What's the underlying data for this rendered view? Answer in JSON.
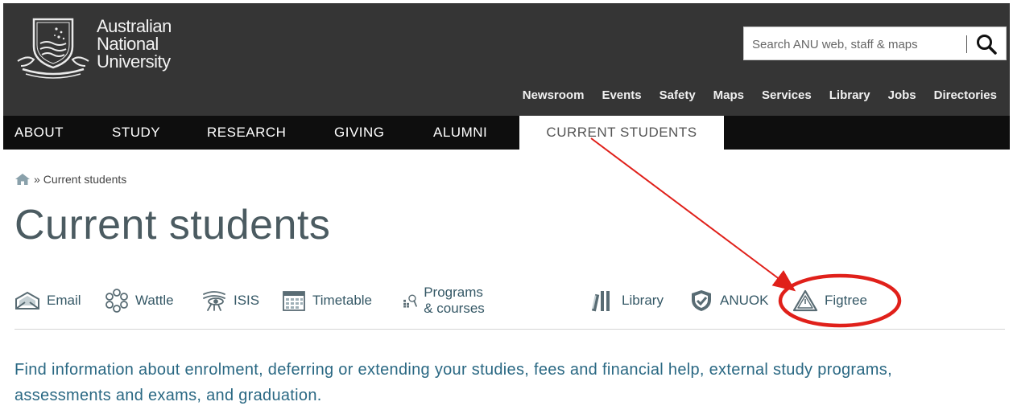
{
  "header": {
    "university_name": [
      "Australian",
      "National",
      "University"
    ],
    "search": {
      "placeholder": "Search ANU web, staff & maps"
    },
    "utility_nav": [
      "Newsroom",
      "Events",
      "Safety",
      "Maps",
      "Services",
      "Library",
      "Jobs",
      "Directories"
    ]
  },
  "main_nav": {
    "items": [
      "ABOUT",
      "STUDY",
      "RESEARCH",
      "GIVING",
      "ALUMNI",
      "CURRENT STUDENTS"
    ],
    "active": "CURRENT STUDENTS"
  },
  "breadcrumb": {
    "separator": "»",
    "current": "Current students"
  },
  "page_title": "Current students",
  "quick_links": [
    {
      "label": "Email",
      "icon": "email-icon"
    },
    {
      "label": "Wattle",
      "icon": "wattle-icon"
    },
    {
      "label": "ISIS",
      "icon": "isis-icon"
    },
    {
      "label": "Timetable",
      "icon": "calendar-icon"
    },
    {
      "label": "Programs & courses",
      "icon": "programs-icon"
    },
    {
      "label": "Library",
      "icon": "books-icon"
    },
    {
      "label": "ANUOK",
      "icon": "shield-icon"
    },
    {
      "label": "Figtree",
      "icon": "warning-triangle-icon"
    }
  ],
  "intro": "Find information about enrolment, deferring or extending your studies, fees and financial help, external study programs, assessments and exams, and graduation.",
  "colors": {
    "header_bg": "#353535",
    "nav_bg": "#0e0e0e",
    "title": "#4b5b61",
    "link": "#355866",
    "intro": "#2a6883",
    "annotation": "#e0201a"
  }
}
